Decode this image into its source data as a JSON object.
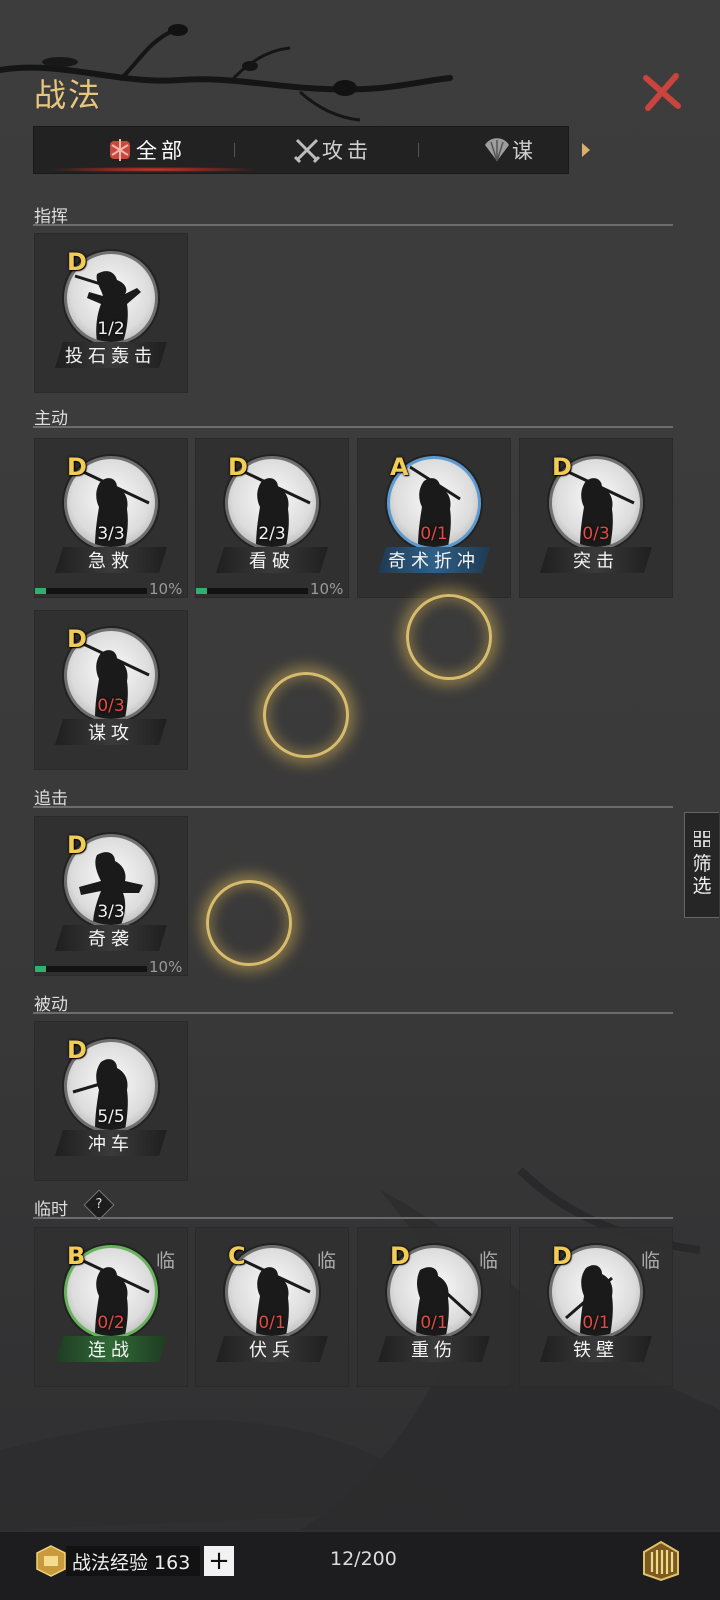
{
  "header": {
    "title": "战法"
  },
  "tabs": [
    {
      "label": "全部",
      "icon": "scroll-bundle-icon",
      "selected": true
    },
    {
      "label": "攻击",
      "icon": "crossed-swords-icon",
      "selected": false
    },
    {
      "label": "谋",
      "icon": "fan-icon",
      "selected": false
    }
  ],
  "sections": {
    "command": {
      "title": "指挥"
    },
    "active": {
      "title": "主动"
    },
    "pursuit": {
      "title": "追击"
    },
    "passive": {
      "title": "被动"
    },
    "temporary": {
      "title": "临时",
      "help_label": "?"
    }
  },
  "cards": {
    "c1": {
      "grade": "D",
      "count": "1/2",
      "name": "投石轰击"
    },
    "a1": {
      "grade": "D",
      "count": "3/3",
      "name": "急救",
      "progress_label": "10%",
      "progress": 0.1
    },
    "a2": {
      "grade": "D",
      "count": "2/3",
      "name": "看破",
      "progress_label": "10%",
      "progress": 0.1
    },
    "a3": {
      "grade": "A",
      "count": "0/1",
      "name": "奇术折冲"
    },
    "a4": {
      "grade": "D",
      "count": "0/3",
      "name": "突击"
    },
    "a5": {
      "grade": "D",
      "count": "0/3",
      "name": "谋攻"
    },
    "p1": {
      "grade": "D",
      "count": "3/3",
      "name": "奇袭",
      "progress_label": "10%",
      "progress": 0.1
    },
    "s1": {
      "grade": "D",
      "count": "5/5",
      "name": "冲车"
    },
    "t1": {
      "grade": "B",
      "count": "0/2",
      "name": "连战",
      "tag": "临"
    },
    "t2": {
      "grade": "C",
      "count": "0/1",
      "name": "伏兵",
      "tag": "临"
    },
    "t3": {
      "grade": "D",
      "count": "0/1",
      "name": "重伤",
      "tag": "临"
    },
    "t4": {
      "grade": "D",
      "count": "0/1",
      "name": "铁壁",
      "tag": "临"
    }
  },
  "side_filter": {
    "label": "筛\n选"
  },
  "footer": {
    "exp_label": "战法经验 163",
    "plus_label": "+",
    "capacity": "12/200"
  },
  "colors": {
    "title_gold": "#e7c77d",
    "grade_gold": "#f2cc55",
    "count_red": "#e24b41",
    "progress_green": "#2fb070",
    "close_red": "#c9443d"
  }
}
